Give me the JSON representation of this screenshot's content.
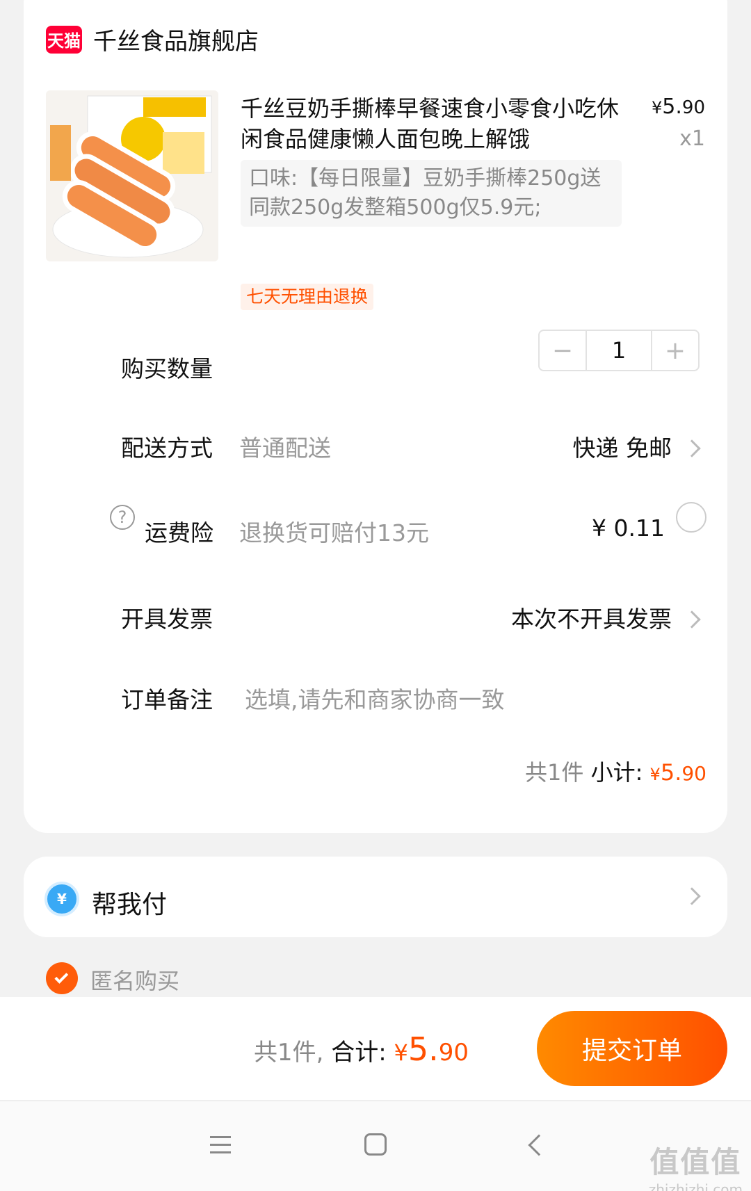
{
  "shop": {
    "badge": "天猫",
    "name": "千丝食品旗舰店"
  },
  "product": {
    "title": "千丝豆奶手撕棒早餐速食小零食小吃休闲食品健康懒人面包晚上解饿",
    "price_symbol": "¥",
    "price_int": "5.",
    "price_dec": "90",
    "quantity_label": "x1",
    "sku": "口味:【每日限量】豆奶手撕棒250g送同款250g发整箱500g仅5.9元;",
    "return_tag": "七天无理由退换"
  },
  "quantity": {
    "label": "购买数量",
    "value": "1",
    "minus": "−",
    "plus": "+"
  },
  "delivery": {
    "label": "配送方式",
    "sub": "普通配送",
    "value": "快递 免邮"
  },
  "insurance": {
    "icon": "?",
    "label": "运费险",
    "sub": "退换货可赔付13元",
    "value": "¥ 0.11"
  },
  "invoice": {
    "label": "开具发票",
    "value": "本次不开具发票"
  },
  "note": {
    "label": "订单备注",
    "placeholder": "选填,请先和商家协商一致"
  },
  "subtotal": {
    "count": "共1件",
    "label": "小计:",
    "symbol": "¥",
    "int": "5.",
    "dec": "90"
  },
  "help_pay": {
    "icon": "¥",
    "label": "帮我付"
  },
  "anonymous": {
    "label": "匿名购买",
    "checked": true
  },
  "footer": {
    "count": "共1件,",
    "label": "合计:",
    "symbol": "¥",
    "int": "5.",
    "dec": "90",
    "submit": "提交订单"
  },
  "watermark": {
    "big": "值值值",
    "small": "zhizhizhi.com"
  },
  "colors": {
    "accent": "#ff5000",
    "tmall": "#ff0036",
    "pay_blue": "#39a9f5"
  }
}
